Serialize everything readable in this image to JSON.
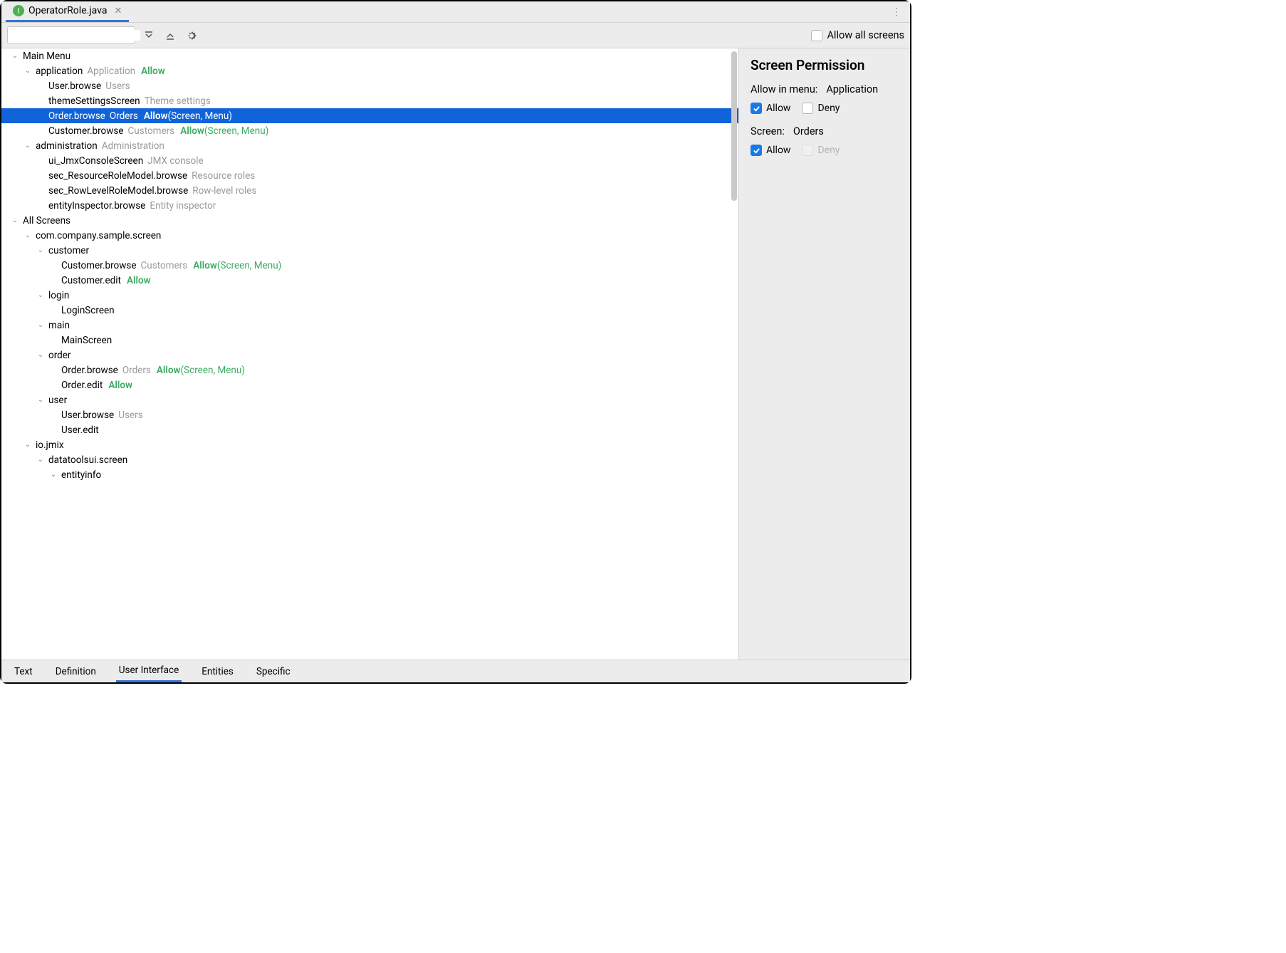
{
  "tab": {
    "icon_letter": "I",
    "title": "OperatorRole.java"
  },
  "toolbar": {
    "search_placeholder": "",
    "allow_all_label": "Allow all screens",
    "allow_all_checked": false
  },
  "tree": [
    {
      "depth": 0,
      "chev": "down",
      "label": "Main Menu"
    },
    {
      "depth": 1,
      "chev": "down",
      "label": "application",
      "hint": "Application",
      "perm": "Allow"
    },
    {
      "depth": 2,
      "label": "User.browse",
      "hint": "Users"
    },
    {
      "depth": 2,
      "label": "themeSettingsScreen",
      "hint": "Theme settings"
    },
    {
      "depth": 2,
      "label": "Order.browse",
      "hint": "Orders",
      "perm": "Allow",
      "perm_detail": "(Screen, Menu)",
      "selected": true
    },
    {
      "depth": 2,
      "label": "Customer.browse",
      "hint": "Customers",
      "perm": "Allow",
      "perm_detail": "(Screen, Menu)"
    },
    {
      "depth": 1,
      "chev": "down",
      "label": "administration",
      "hint": "Administration"
    },
    {
      "depth": 2,
      "label": "ui_JmxConsoleScreen",
      "hint": "JMX console"
    },
    {
      "depth": 2,
      "label": "sec_ResourceRoleModel.browse",
      "hint": "Resource roles"
    },
    {
      "depth": 2,
      "label": "sec_RowLevelRoleModel.browse",
      "hint": "Row-level roles"
    },
    {
      "depth": 2,
      "label": "entityInspector.browse",
      "hint": "Entity inspector"
    },
    {
      "depth": 0,
      "chev": "down",
      "label": "All Screens"
    },
    {
      "depth": 1,
      "chev": "down",
      "label": "com.company.sample.screen"
    },
    {
      "depth": 2,
      "chev": "down",
      "label": "customer"
    },
    {
      "depth": 3,
      "label": "Customer.browse",
      "hint": "Customers",
      "perm": "Allow",
      "perm_detail": "(Screen, Menu)"
    },
    {
      "depth": 3,
      "label": "Customer.edit",
      "perm": "Allow"
    },
    {
      "depth": 2,
      "chev": "down",
      "label": "login"
    },
    {
      "depth": 3,
      "label": "LoginScreen"
    },
    {
      "depth": 2,
      "chev": "down",
      "label": "main"
    },
    {
      "depth": 3,
      "label": "MainScreen"
    },
    {
      "depth": 2,
      "chev": "down",
      "label": "order"
    },
    {
      "depth": 3,
      "label": "Order.browse",
      "hint": "Orders",
      "perm": "Allow",
      "perm_detail": "(Screen, Menu)"
    },
    {
      "depth": 3,
      "label": "Order.edit",
      "perm": "Allow"
    },
    {
      "depth": 2,
      "chev": "down",
      "label": "user"
    },
    {
      "depth": 3,
      "label": "User.browse",
      "hint": "Users"
    },
    {
      "depth": 3,
      "label": "User.edit"
    },
    {
      "depth": 1,
      "chev": "down",
      "label": "io.jmix"
    },
    {
      "depth": 2,
      "chev": "down",
      "label": "datatoolsui.screen"
    },
    {
      "depth": 3,
      "chev": "down",
      "label": "entityinfo"
    }
  ],
  "side": {
    "title": "Screen Permission",
    "menu_label": "Allow in menu:",
    "menu_value": "Application",
    "menu_allow_checked": true,
    "menu_deny_checked": false,
    "menu_deny_disabled": false,
    "screen_label": "Screen:",
    "screen_value": "Orders",
    "screen_allow_checked": true,
    "screen_deny_checked": false,
    "screen_deny_disabled": true,
    "allow_text": "Allow",
    "deny_text": "Deny"
  },
  "bottom_tabs": {
    "items": [
      "Text",
      "Definition",
      "User Interface",
      "Entities",
      "Specific"
    ],
    "active": 2
  }
}
